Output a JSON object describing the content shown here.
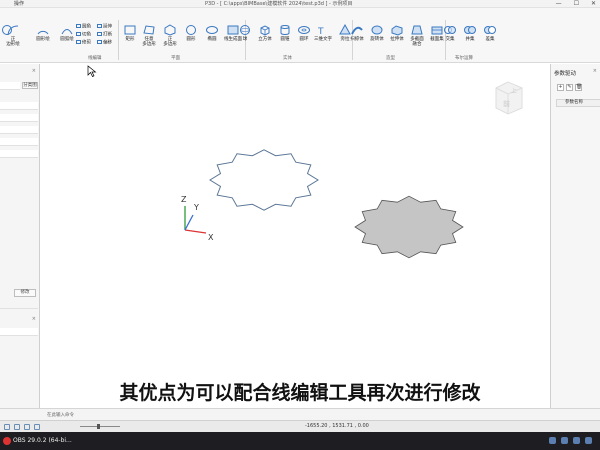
{
  "window": {
    "title": "P3D - [ C:\\apps\\BIMBase\\建模软件 2024\\test.p3d ] - 示例项目",
    "menu": [
      "",
      "操作"
    ],
    "controls": [
      "—",
      "☐",
      "✕"
    ]
  },
  "ribbon": {
    "tools_left": [
      {
        "icon": "circle-icon",
        "label": ""
      },
      {
        "icon": "arc-icon",
        "label": "正\n边形绘"
      },
      {
        "icon": "arc2-icon",
        "label": "圆形绘"
      },
      {
        "icon": "arc3-icon",
        "label": "圆弧绘"
      },
      {
        "icon": "ellipse-arc-icon",
        "label": "椭圆弧绘"
      }
    ],
    "small_tools": [
      {
        "label": "圆角"
      },
      {
        "label": "切角"
      },
      {
        "label": "修剪"
      },
      {
        "label": "延伸"
      },
      {
        "label": "打断"
      },
      {
        "label": "偏移"
      }
    ],
    "group_edit_label": "线编辑",
    "plane_tools": [
      {
        "icon": "rect-icon",
        "label": "矩形"
      },
      {
        "icon": "polygon-icon",
        "label": "任意\n多边形"
      },
      {
        "icon": "regular-polygon-icon",
        "label": "正\n多边形"
      },
      {
        "icon": "circle-shape-icon",
        "label": "圆形"
      },
      {
        "icon": "ellipse-icon",
        "label": "椭圆"
      },
      {
        "icon": "closed-face-icon",
        "label": "线生成面"
      }
    ],
    "group_plane_label": "平面",
    "solid_tools": [
      {
        "icon": "sphere-icon",
        "label": "球"
      },
      {
        "icon": "cube-icon",
        "label": "立方体"
      },
      {
        "icon": "cylinder-icon",
        "label": "圆锥"
      },
      {
        "icon": "torus-icon",
        "label": "圆环"
      },
      {
        "icon": "text3d-icon",
        "label": "三维文字"
      },
      {
        "icon": "prism-icon",
        "label": "旁拉"
      }
    ],
    "group_solid_label": "实体",
    "model_tools": [
      {
        "icon": "sweep-icon",
        "label": "扫掠体"
      },
      {
        "icon": "revolve-icon",
        "label": "旋转体"
      },
      {
        "icon": "extrude-icon",
        "label": "拉伸体"
      },
      {
        "icon": "loft-icon",
        "label": "多截面\n融合"
      },
      {
        "icon": "section-icon",
        "label": "截面集"
      }
    ],
    "group_model_label": "造型",
    "bool_tools": [
      {
        "icon": "intersect-icon",
        "label": "交集"
      },
      {
        "icon": "union-icon",
        "label": "并集"
      },
      {
        "icon": "subtract-icon",
        "label": "差集"
      }
    ],
    "group_bool_label": "布尔运算"
  },
  "left_panel": {
    "field_btn": "分类图",
    "modify_btn": "修改",
    "close": "×"
  },
  "right_panel": {
    "title": "参数驱动",
    "close": "×",
    "buttons": [
      "+",
      "✎",
      "🗑"
    ],
    "table_header": "参数名称"
  },
  "viewcube": {
    "front_label": "前",
    "top_label": "上"
  },
  "axes": {
    "x": "X",
    "y": "Y",
    "z": "Z"
  },
  "command": {
    "placeholder": "在此输入命令"
  },
  "status": {
    "coords": "-1655.20 , 1531.71 , 0.00"
  },
  "taskbar": {
    "app": "OBS 29.0.2 (64-bi..."
  },
  "subtitle": "其优点为可以配合线编辑工具再次进行修改",
  "colors": {
    "star_outline": "#5b7696",
    "star_fill": "#c5c5c5",
    "accent": "#3a78c2"
  }
}
